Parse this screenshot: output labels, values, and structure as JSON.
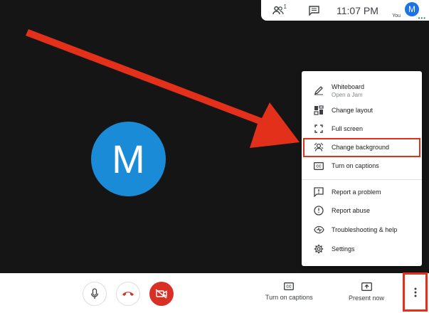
{
  "topbar": {
    "participant_count": "1",
    "time": "11:07 PM",
    "avatar_initial": "M",
    "you_label": "You",
    "dots": "•••"
  },
  "main": {
    "avatar_initial": "M"
  },
  "menu": {
    "items": [
      {
        "label": "Whiteboard",
        "sublabel": "Open a Jam",
        "icon": "pen-icon"
      },
      {
        "label": "Change layout",
        "icon": "layout-icon"
      },
      {
        "label": "Full screen",
        "icon": "fullscreen-icon"
      },
      {
        "label": "Change background",
        "icon": "background-icon"
      },
      {
        "label": "Turn on captions",
        "icon": "captions-icon"
      },
      {
        "label": "Report a problem",
        "icon": "report-problem-icon"
      },
      {
        "label": "Report abuse",
        "icon": "report-abuse-icon"
      },
      {
        "label": "Troubleshooting & help",
        "icon": "troubleshooting-icon"
      },
      {
        "label": "Settings",
        "icon": "gear-icon"
      }
    ]
  },
  "bottombar": {
    "captions_label": "Turn on captions",
    "present_label": "Present now"
  },
  "colors": {
    "annotation_red": "#e2301a",
    "avatar_blue": "#1a8bd6",
    "end_call_red": "#d93025"
  }
}
